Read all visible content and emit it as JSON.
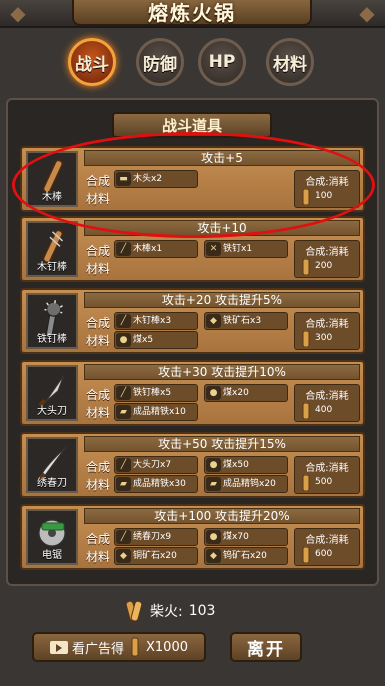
{
  "title": "熔炼火锅",
  "tabs": [
    {
      "label": "战斗",
      "active": true
    },
    {
      "label": "防御",
      "active": false
    },
    {
      "label": "HP",
      "active": false
    },
    {
      "label": "材料",
      "active": false
    }
  ],
  "section_title": "战斗道具",
  "labels": {
    "synth": "合成",
    "material": "材料",
    "cost": "合成:消耗"
  },
  "items": [
    {
      "name": "木棒",
      "icon": "wooden-stick-icon",
      "effect": "攻击+5",
      "materials": [
        {
          "name": "木头",
          "count": "x2",
          "icon": "wood-log-icon"
        }
      ],
      "cost": "100"
    },
    {
      "name": "木钉棒",
      "icon": "spiked-club-icon",
      "effect": "攻击+10",
      "materials": [
        {
          "name": "木棒",
          "count": "x1",
          "icon": "wooden-stick-icon"
        },
        {
          "name": "铁钉",
          "count": "x1",
          "icon": "nail-icon"
        }
      ],
      "cost": "200"
    },
    {
      "name": "铁钉棒",
      "icon": "iron-spiked-club-icon",
      "effect": "攻击+20 攻击提升5%",
      "materials": [
        {
          "name": "木钉棒",
          "count": "x3",
          "icon": "spiked-club-icon"
        },
        {
          "name": "铁矿石",
          "count": "x3",
          "icon": "iron-ore-icon"
        },
        {
          "name": "煤",
          "count": "x5",
          "icon": "coal-icon"
        }
      ],
      "cost": "300"
    },
    {
      "name": "大头刀",
      "icon": "broad-blade-icon",
      "effect": "攻击+30 攻击提升10%",
      "materials": [
        {
          "name": "铁钉棒",
          "count": "x5",
          "icon": "iron-spiked-club-icon"
        },
        {
          "name": "煤",
          "count": "x20",
          "icon": "coal-icon"
        },
        {
          "name": "成品精铁",
          "count": "x10",
          "icon": "refined-iron-icon"
        }
      ],
      "cost": "400"
    },
    {
      "name": "绣春刀",
      "icon": "curved-sword-icon",
      "effect": "攻击+50 攻击提升15%",
      "materials": [
        {
          "name": "大头刀",
          "count": "x7",
          "icon": "broad-blade-icon"
        },
        {
          "name": "煤",
          "count": "x50",
          "icon": "coal-icon"
        },
        {
          "name": "成品精铁",
          "count": "x30",
          "icon": "refined-iron-icon"
        },
        {
          "name": "成品精钨",
          "count": "x20",
          "icon": "refined-tungsten-icon"
        }
      ],
      "cost": "500"
    },
    {
      "name": "电锯",
      "icon": "chainsaw-icon",
      "effect": "攻击+100 攻击提升20%",
      "materials": [
        {
          "name": "绣春刀",
          "count": "x9",
          "icon": "curved-sword-icon"
        },
        {
          "name": "煤",
          "count": "x70",
          "icon": "coal-icon"
        },
        {
          "name": "铜矿石",
          "count": "x20",
          "icon": "copper-ore-icon"
        },
        {
          "name": "钨矿石",
          "count": "x20",
          "icon": "tungsten-ore-icon"
        }
      ],
      "cost": "600"
    }
  ],
  "firewood": {
    "label": "柴火:",
    "value": "103"
  },
  "ad_button": {
    "label": "看广告得",
    "reward": "X1000"
  },
  "leave_button": "离开",
  "colors": {
    "accent": "#f3a33a",
    "highlight": "#e01010",
    "card": "#c58f52"
  }
}
